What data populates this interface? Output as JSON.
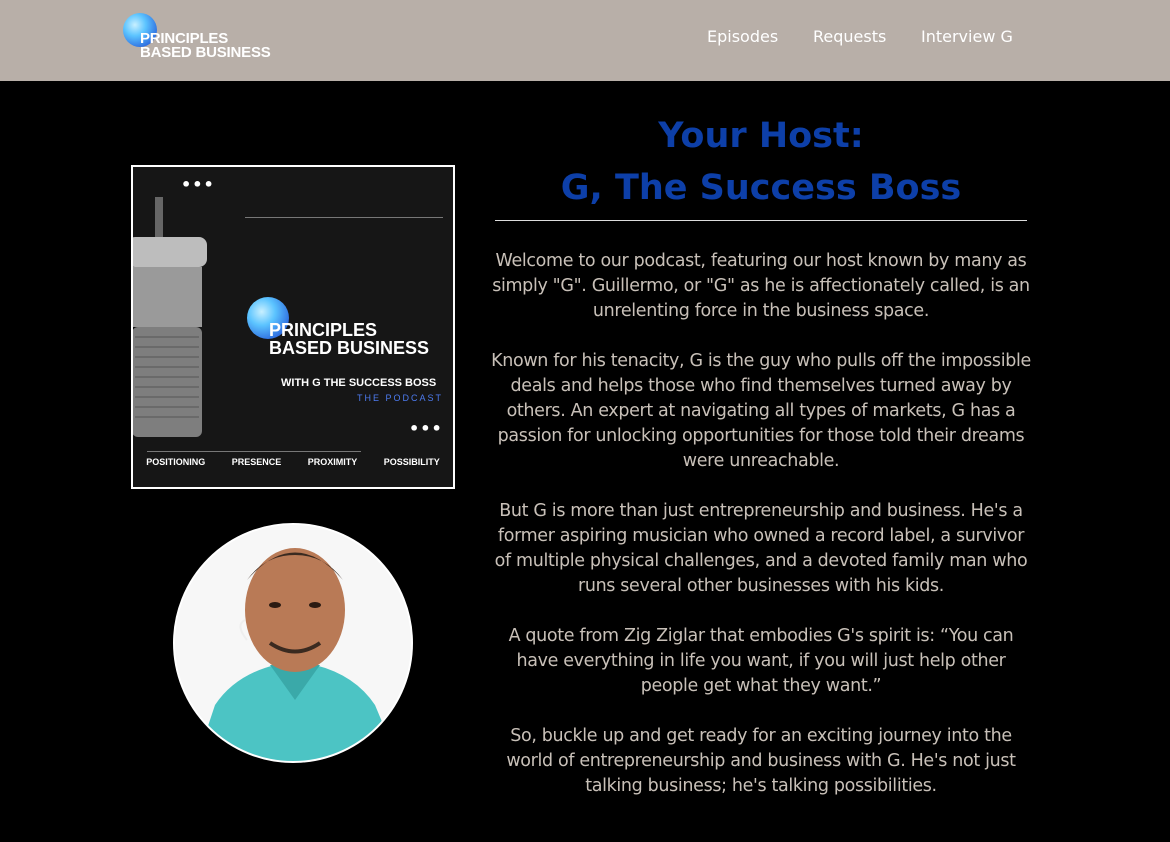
{
  "header": {
    "logo_text_line1": "PRINCIPLES",
    "logo_text_line2": "BASED BUSINESS",
    "nav": [
      "Episodes",
      "Requests",
      "Interview G"
    ]
  },
  "cover": {
    "title_line1": "PRINCIPLES",
    "title_line2": "BASED BUSINESS",
    "subtitle": "WITH G THE SUCCESS BOSS",
    "podcast_label": "THE PODCAST",
    "pillars": [
      "POSITIONING",
      "PRESENCE",
      "PROXIMITY",
      "POSSIBILITY"
    ]
  },
  "main": {
    "title_line1": "Your Host:",
    "title_line2": "G, The Success Boss",
    "paragraphs": [
      "Welcome to our podcast, featuring our host known by many as simply \"G\". Guillermo, or \"G\" as he is affectionately called, is an unrelenting force in the business space.",
      "Known for his tenacity, G is the guy who pulls off the impossible deals and helps those who find themselves turned away by others. An expert at navigating all types of markets, G has a passion for unlocking opportunities for those told their dreams were unreachable.",
      "But G is more than just entrepreneurship and business. He's a former aspiring musician who owned a record label, a survivor of multiple physical challenges, and a devoted family man who runs several other businesses with his kids.",
      "A quote from Zig Ziglar that embodies G's spirit is: “You can have everything in life you want, if you will just help other people get what they want.”",
      "So, buckle up and get ready for an exciting journey into the world of entrepreneurship and business with G. He's not just talking business; he's talking possibilities."
    ]
  },
  "colors": {
    "header_bg": "#b8afa8",
    "title_blue": "#0d3fa8",
    "body_text": "#c8c0b8",
    "page_bg": "#000000"
  }
}
